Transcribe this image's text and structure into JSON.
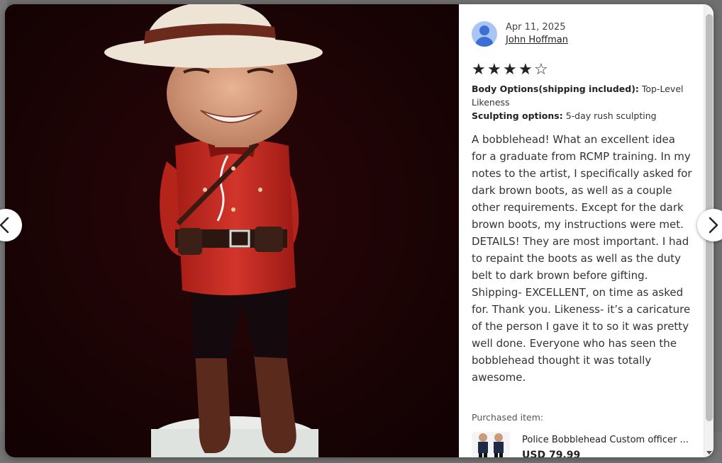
{
  "review": {
    "date": "Apr 11, 2025",
    "reviewer_name": "John Hoffman",
    "rating": 4,
    "rating_max": 5,
    "options": [
      {
        "label": "Body Options(shipping included):",
        "value": "Top-Level Likeness"
      },
      {
        "label": "Sculpting options:",
        "value": "5-day rush sculpting"
      }
    ],
    "text": "A bobblehead! What an excellent idea for a graduate from RCMP training. In my notes to the artist, I specifically asked for dark brown boots, as well as a couple other requirements. Except for the dark brown boots, my instructions were met. DETAILS! They are most important. I had to repaint the boots as well as the duty belt to dark brown before gifting. Shipping- EXCELLENT, on time as asked for. Thank you. Likeness- it’s a caricature of the person I gave it to so it was pretty well done. Everyone who has seen the bobblehead thought it was totally awesome."
  },
  "purchased": {
    "label": "Purchased item:",
    "title": "Police Bobblehead Custom officer ...",
    "price": "USD 79.99"
  },
  "icons": {
    "prev": "chevron-left-icon",
    "next": "chevron-right-icon",
    "avatar": "user-avatar-icon"
  },
  "colors": {
    "star": "#222222",
    "photo_background": "#1b0405",
    "uniform_red": "#c62a1f",
    "hat": "#ede4d6"
  }
}
